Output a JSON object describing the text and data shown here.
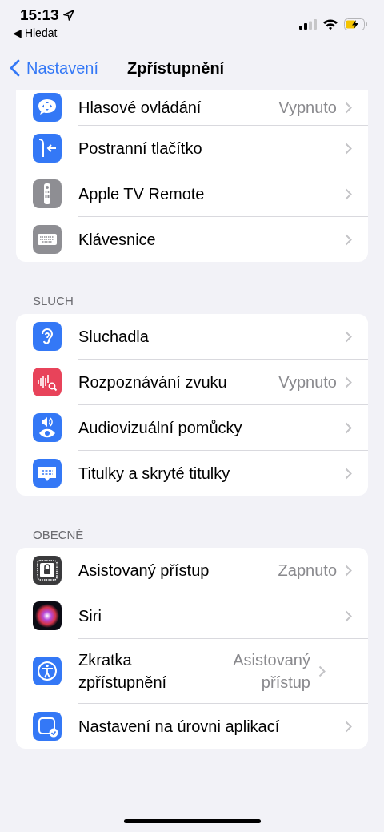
{
  "status_bar": {
    "time": "15:13",
    "back_app": "◀ Hledat"
  },
  "nav": {
    "back": "Nastavení",
    "title": "Zpřístupnění"
  },
  "sections": [
    {
      "rows": [
        {
          "label": "Hlasové ovládání",
          "value": "Vypnuto"
        },
        {
          "label": "Postranní tlačítko"
        },
        {
          "label": "Apple TV Remote"
        },
        {
          "label": "Klávesnice"
        }
      ]
    },
    {
      "header": "SLUCH",
      "rows": [
        {
          "label": "Sluchadla"
        },
        {
          "label": "Rozpoznávání zvuku",
          "value": "Vypnuto"
        },
        {
          "label": "Audiovizuální pomůcky"
        },
        {
          "label": "Titulky a skryté titulky"
        }
      ]
    },
    {
      "header": "OBECNÉ",
      "rows": [
        {
          "label": "Asistovaný přístup",
          "value": "Zapnuto"
        },
        {
          "label": "Siri"
        },
        {
          "label": "Zkratka zpřístupnění",
          "value": "Asistovaný přístup"
        },
        {
          "label": "Nastavení na úrovni aplikací"
        }
      ]
    }
  ]
}
